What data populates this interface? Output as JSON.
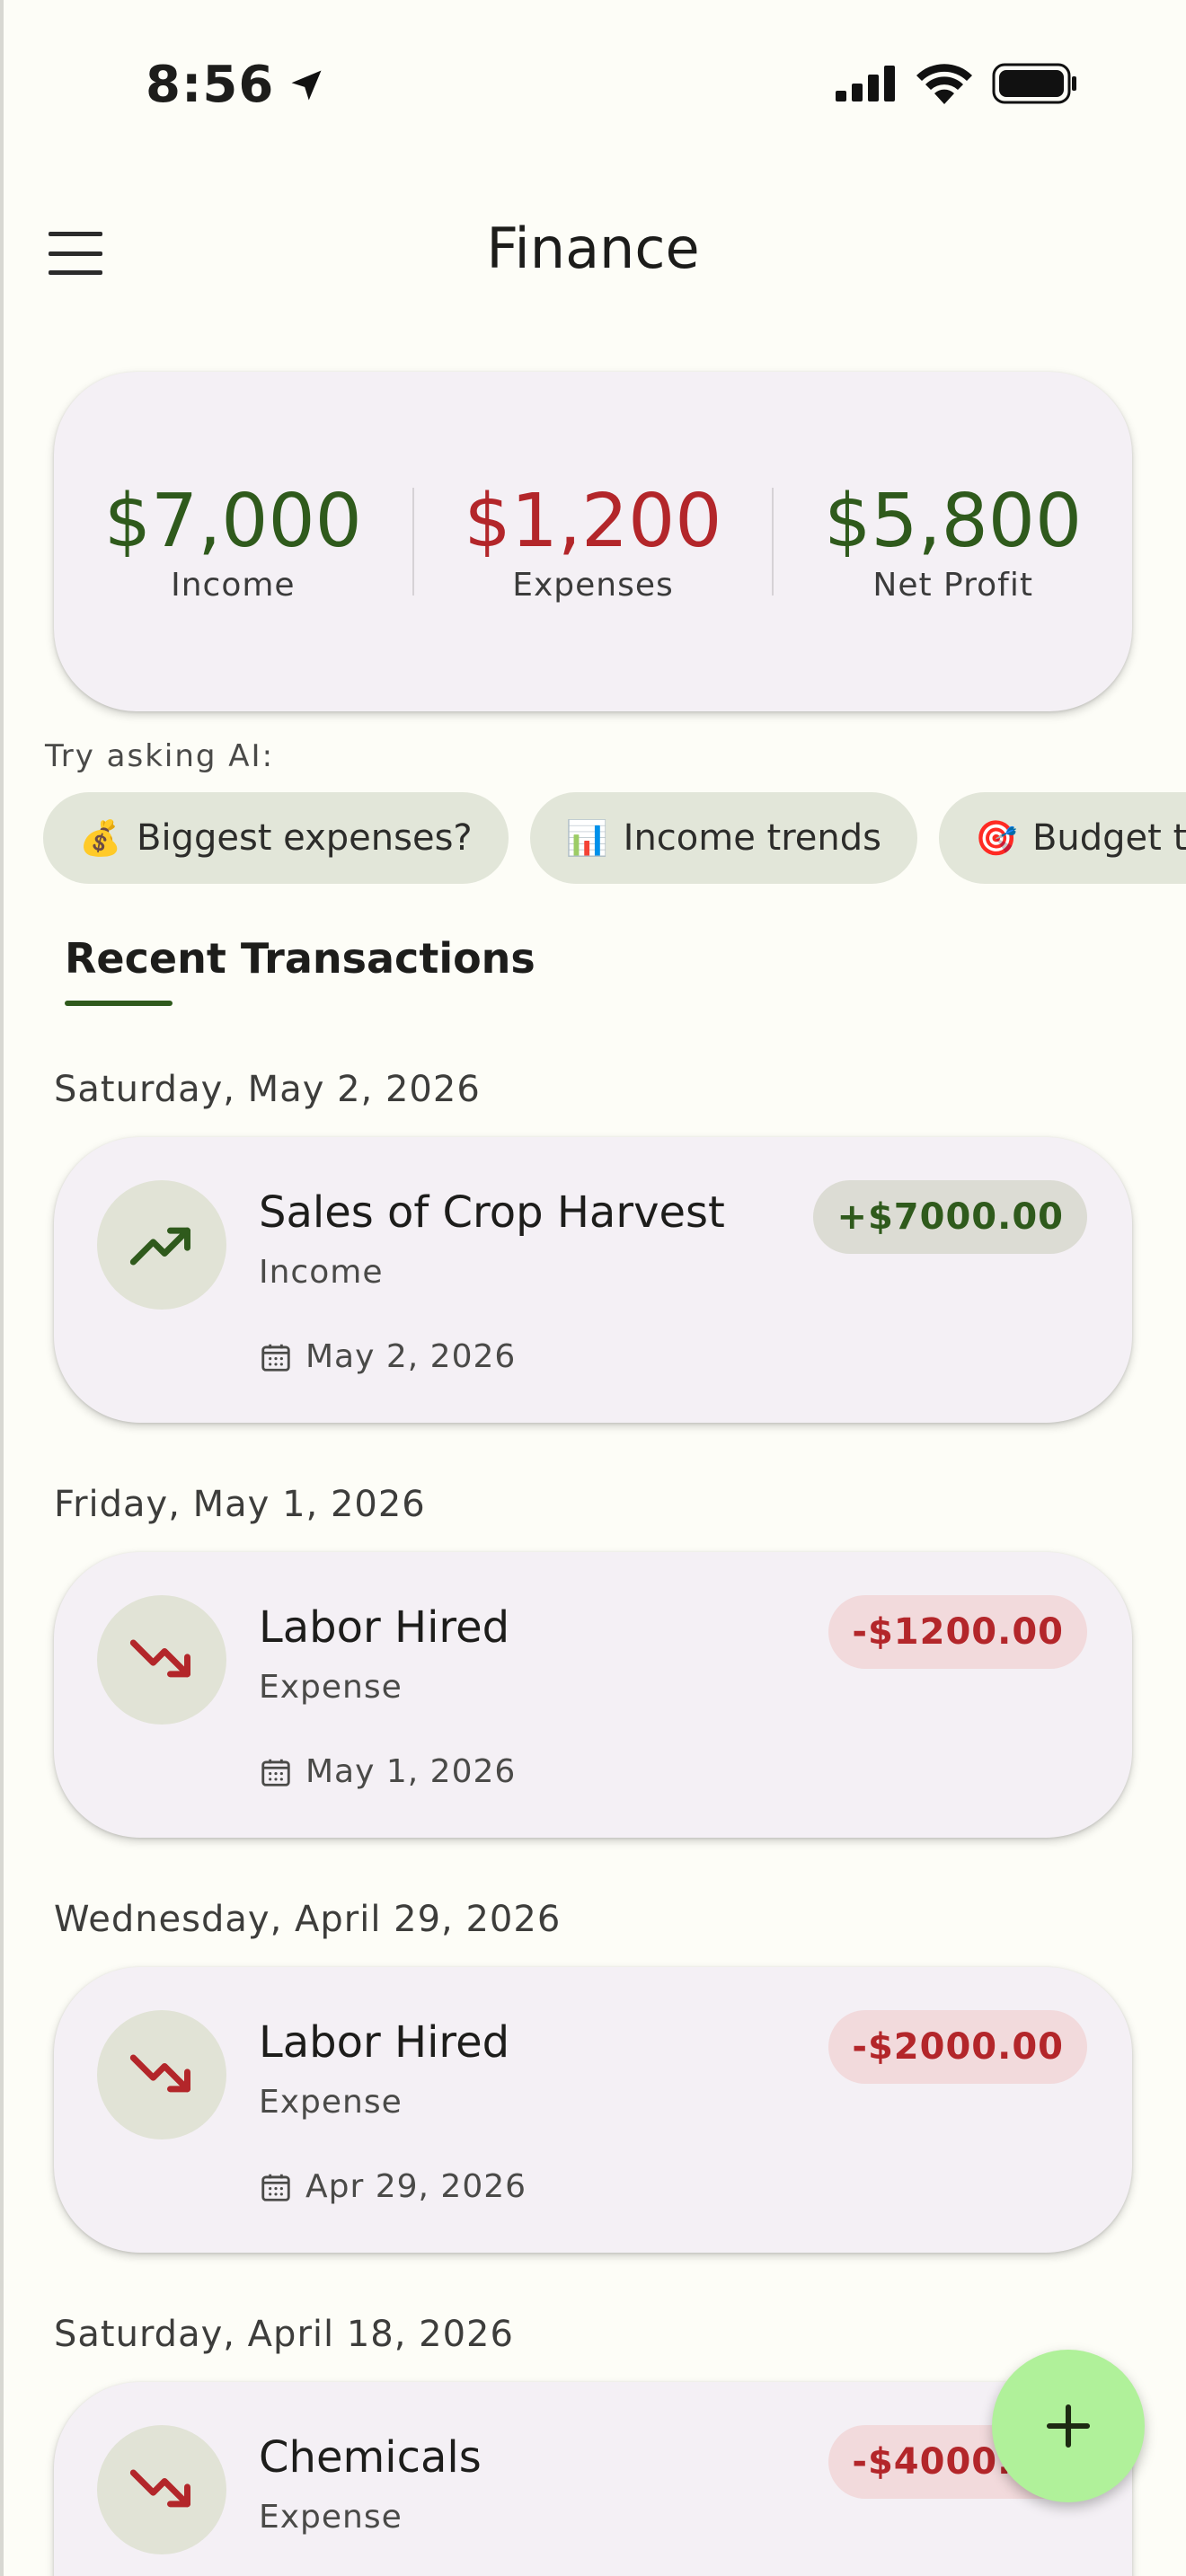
{
  "status_bar": {
    "time": "8:56"
  },
  "header": {
    "title": "Finance"
  },
  "summary": {
    "income": {
      "value": "$7,000",
      "label": "Income",
      "color": "#2f5a1c"
    },
    "expenses": {
      "value": "$1,200",
      "label": "Expenses",
      "color": "#b3262a"
    },
    "net_profit": {
      "value": "$5,800",
      "label": "Net Profit",
      "color": "#2f5a1c"
    }
  },
  "ai": {
    "label": "Try asking AI:",
    "chips": [
      {
        "icon": "money-bag-icon",
        "emoji": "💰",
        "label": "Biggest expenses?"
      },
      {
        "icon": "bar-chart-icon",
        "emoji": "📊",
        "label": "Income trends"
      },
      {
        "icon": "target-icon",
        "emoji": "🎯",
        "label": "Budget tips"
      }
    ]
  },
  "section": {
    "title": "Recent Transactions"
  },
  "groups": [
    {
      "date_header": "Saturday, May 2, 2026",
      "tx": {
        "title": "Sales of Crop Harvest",
        "type": "Income",
        "date": "May 2, 2026",
        "amount": "+$7000.00",
        "kind": "income"
      }
    },
    {
      "date_header": "Friday, May 1, 2026",
      "tx": {
        "title": "Labor Hired",
        "type": "Expense",
        "date": "May 1, 2026",
        "amount": "-$1200.00",
        "kind": "expense"
      }
    },
    {
      "date_header": "Wednesday, April 29, 2026",
      "tx": {
        "title": "Labor Hired",
        "type": "Expense",
        "date": "Apr 29, 2026",
        "amount": "-$2000.00",
        "kind": "expense"
      }
    },
    {
      "date_header": "Saturday, April 18, 2026",
      "tx": {
        "title": "Chemicals",
        "type": "Expense",
        "date": "",
        "amount": "-$4000.00",
        "kind": "expense"
      }
    }
  ],
  "colors": {
    "income_green": "#2f5a1c",
    "expense_red": "#b3262a",
    "income_badge_bg": "#dcdcd4",
    "expense_badge_bg": "#f2dadc",
    "fab_bg": "#b0f19a"
  },
  "fab": {
    "icon": "plus-icon"
  }
}
